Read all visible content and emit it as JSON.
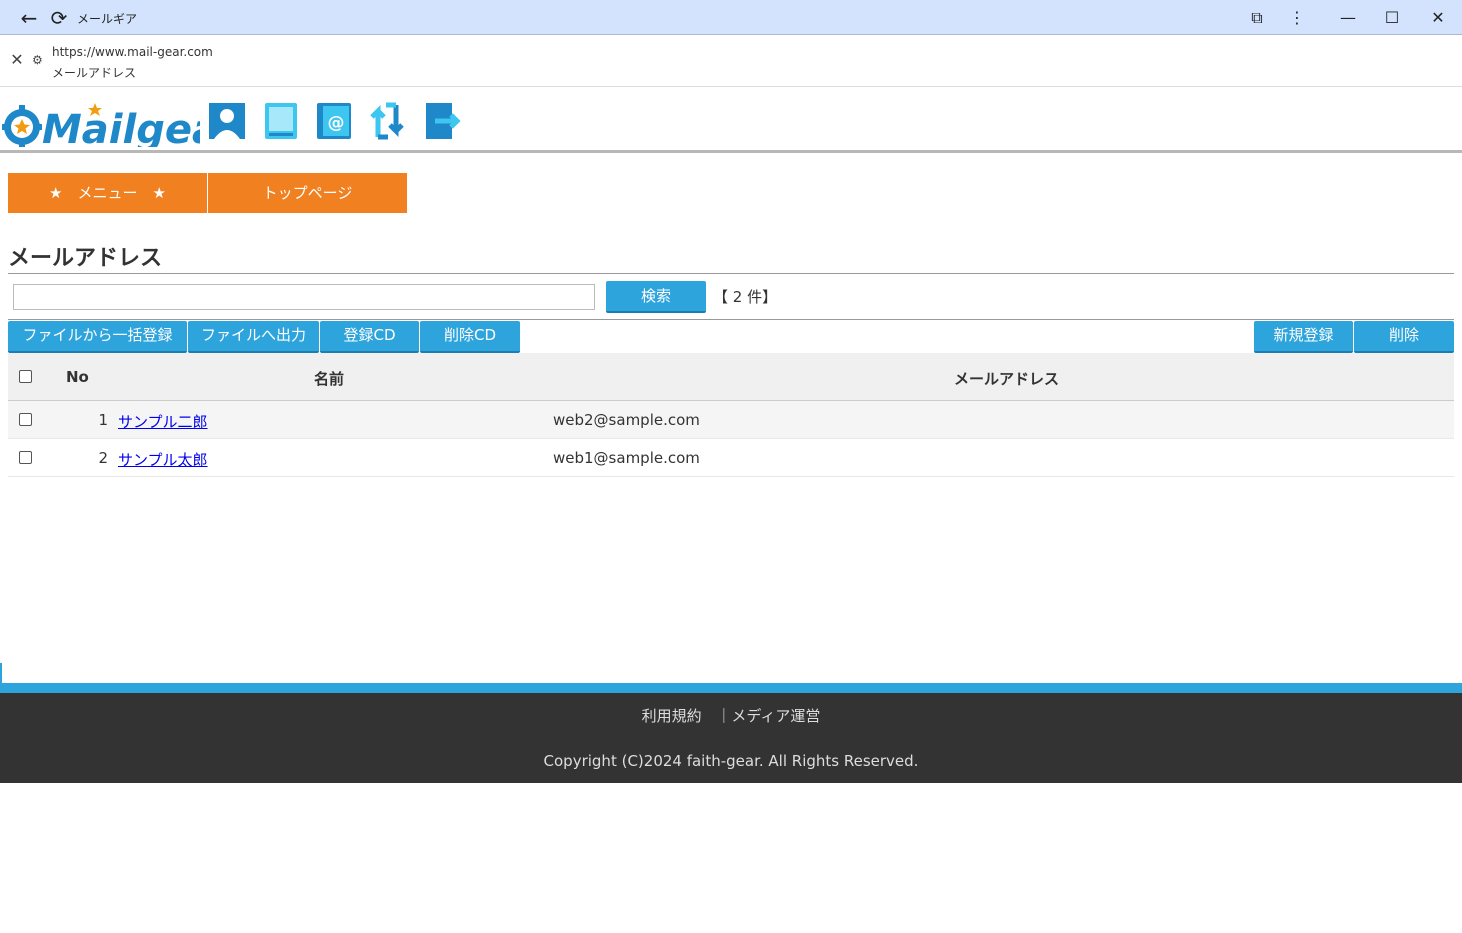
{
  "window": {
    "title": "メールギア",
    "back_glyph": "←",
    "reload_glyph": "⟳",
    "extension_glyph": "⧉",
    "menu_glyph": "⋮",
    "minimize_glyph": "—",
    "maximize_glyph": "☐",
    "close_glyph": "✕"
  },
  "address": {
    "close_glyph": "✕",
    "site_info_glyph": "⚙",
    "url": "https://www.mail-gear.com",
    "page_title": "メールアドレス"
  },
  "header": {
    "logo_text": "Mailgear",
    "icons": [
      "user-icon",
      "book-icon",
      "address-book-icon",
      "sync-icon",
      "logout-icon"
    ]
  },
  "menu": {
    "menu_label": "★　メニュー　★",
    "top_label": "トップページ"
  },
  "page": {
    "title": "メールアドレス"
  },
  "search": {
    "value": "",
    "button_label": "検索",
    "count_label": "【 2 件】"
  },
  "toolbar": {
    "bulk_import": "ファイルから一括登録",
    "export": "ファイルへ出力",
    "register_cd": "登録CD",
    "delete_cd": "削除CD",
    "new": "新規登録",
    "delete": "削除"
  },
  "table": {
    "headers": {
      "no": "No",
      "name": "名前",
      "email": "メールアドレス"
    },
    "rows": [
      {
        "no": "1",
        "name": "サンプル二郎",
        "email": "web2@sample.com"
      },
      {
        "no": "2",
        "name": "サンプル太郎",
        "email": "web1@sample.com"
      }
    ]
  },
  "footer": {
    "terms": "利用規約",
    "separator": "｜",
    "media": "メディア運営",
    "copyright": "Copyright (C)2024 faith-gear. All Rights Reserved."
  },
  "colors": {
    "accent_blue": "#2ea4dc",
    "menu_orange": "#f08020",
    "footer_dark": "#333333",
    "titlebar": "#d3e3fd"
  }
}
